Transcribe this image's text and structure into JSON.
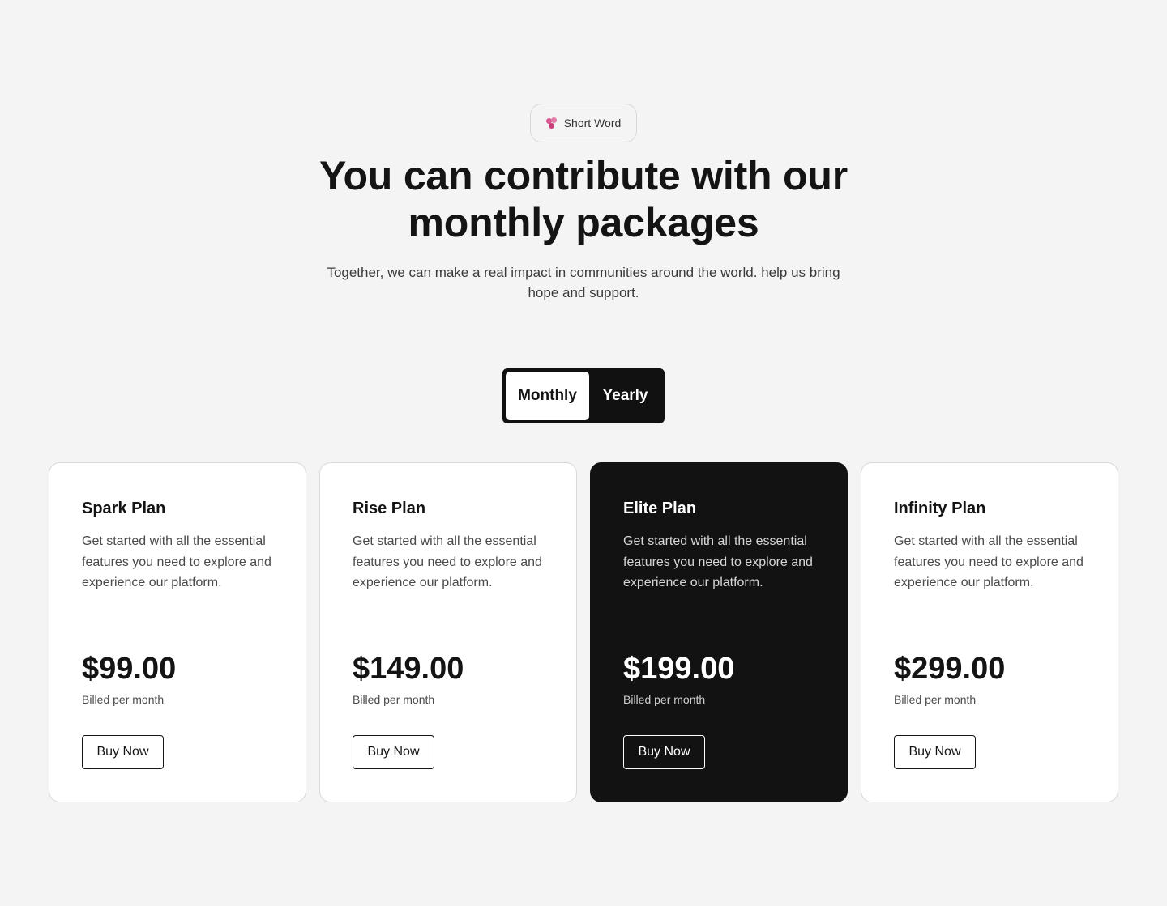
{
  "badge": {
    "label": "Short Word",
    "icon": "flower-icon",
    "icon_color": "#d9568e"
  },
  "hero": {
    "title": "You can contribute with our monthly packages",
    "subtitle": "Together, we can make a real impact in communities around the world. help us bring hope and support."
  },
  "billing_toggle": {
    "options": [
      {
        "label": "Monthly",
        "selected": true
      },
      {
        "label": "Yearly",
        "selected": false
      }
    ]
  },
  "plans": [
    {
      "name": "Spark Plan",
      "description": "Get started with all the essential features you need to explore and experience our platform.",
      "price": "$99.00",
      "billing": "Billed per month",
      "cta": "Buy Now",
      "highlighted": false
    },
    {
      "name": "Rise Plan",
      "description": "Get started with all the essential features you need to explore and experience our platform.",
      "price": "$149.00",
      "billing": "Billed per month",
      "cta": "Buy Now",
      "highlighted": false
    },
    {
      "name": "Elite Plan",
      "description": "Get started with all the essential features you need to explore and experience our platform.",
      "price": "$199.00",
      "billing": "Billed per month",
      "cta": "Buy Now",
      "highlighted": true
    },
    {
      "name": "Infinity Plan",
      "description": "Get started with all the essential features you need to explore and experience our platform.",
      "price": "$299.00",
      "billing": "Billed per month",
      "cta": "Buy Now",
      "highlighted": false
    }
  ],
  "colors": {
    "background": "#f4f4f4",
    "dark": "#121212",
    "card": "#ffffff",
    "accent": "#d9568e"
  }
}
